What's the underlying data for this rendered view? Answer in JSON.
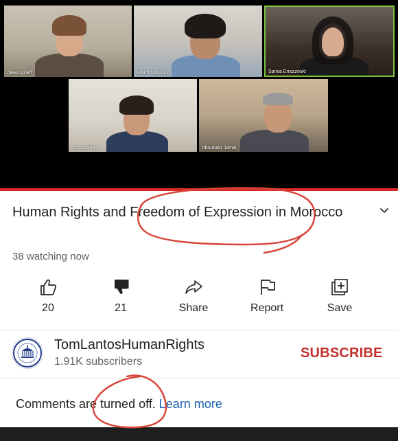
{
  "video": {
    "participants": [
      {
        "name": "Alexis Arieff"
      },
      {
        "name": "Sherif Mansour"
      },
      {
        "name": "Samia Errazzouki"
      },
      {
        "name": "Intissar Fakir"
      },
      {
        "name": "Aboubakr Jamai"
      }
    ]
  },
  "title": "Human Rights and Freedom of Expression in Morocco",
  "watching": "38 watching now",
  "actions": {
    "like": {
      "label": "20",
      "icon": "thumbs-up-outline"
    },
    "dislike": {
      "label": "21",
      "icon": "thumbs-down-filled"
    },
    "share": {
      "label": "Share",
      "icon": "share-arrow"
    },
    "report": {
      "label": "Report",
      "icon": "flag"
    },
    "save": {
      "label": "Save",
      "icon": "playlist-add"
    }
  },
  "channel": {
    "name": "TomLantosHumanRights",
    "subscribers": "1.91K subscribers",
    "subscribe_label": "SUBSCRIBE"
  },
  "comments": {
    "status": "Comments are turned off.",
    "link": "Learn more"
  },
  "colors": {
    "progress": "#d62b26",
    "subscribe": "#c4302b",
    "link": "#1a5fb4",
    "annotation": "#d9463b",
    "active_speaker_border": "#7cc142"
  }
}
